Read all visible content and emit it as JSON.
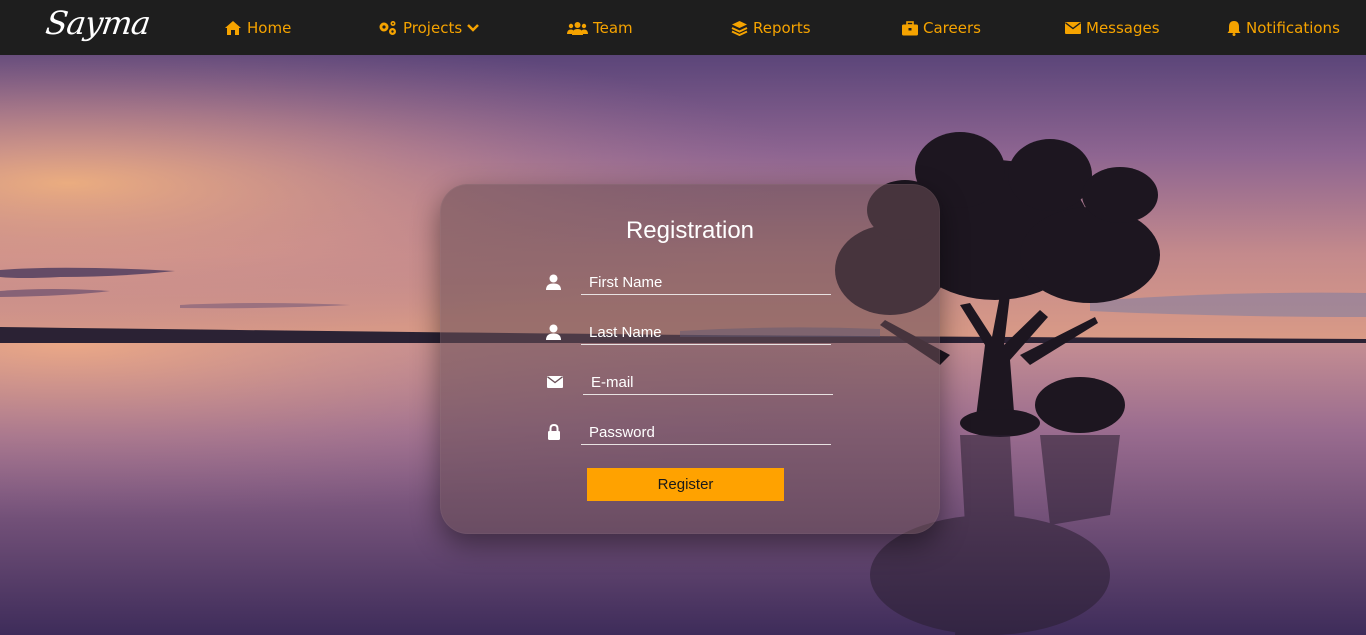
{
  "brand": "Sayma",
  "nav": {
    "items": [
      {
        "label": "Home",
        "icon": "home-icon"
      },
      {
        "label": "Projects",
        "icon": "gears-icon",
        "dropdown": "chevron-down-icon"
      },
      {
        "label": "Team",
        "icon": "users-icon"
      },
      {
        "label": "Reports",
        "icon": "layers-icon"
      },
      {
        "label": "Careers",
        "icon": "briefcase-icon"
      },
      {
        "label": "Messages",
        "icon": "envelope-icon"
      },
      {
        "label": "Notifications",
        "icon": "bell-icon"
      }
    ]
  },
  "form": {
    "title": "Registration",
    "fields": [
      {
        "placeholder": "First Name",
        "icon": "user-icon"
      },
      {
        "placeholder": "Last Name",
        "icon": "user-icon"
      },
      {
        "placeholder": "E-mail",
        "icon": "envelope-icon"
      },
      {
        "placeholder": "Password",
        "icon": "lock-icon"
      }
    ],
    "submit_label": "Register"
  },
  "colors": {
    "accent": "#f5a300",
    "button": "#ffa200",
    "navbar": "#1e1e1e"
  }
}
